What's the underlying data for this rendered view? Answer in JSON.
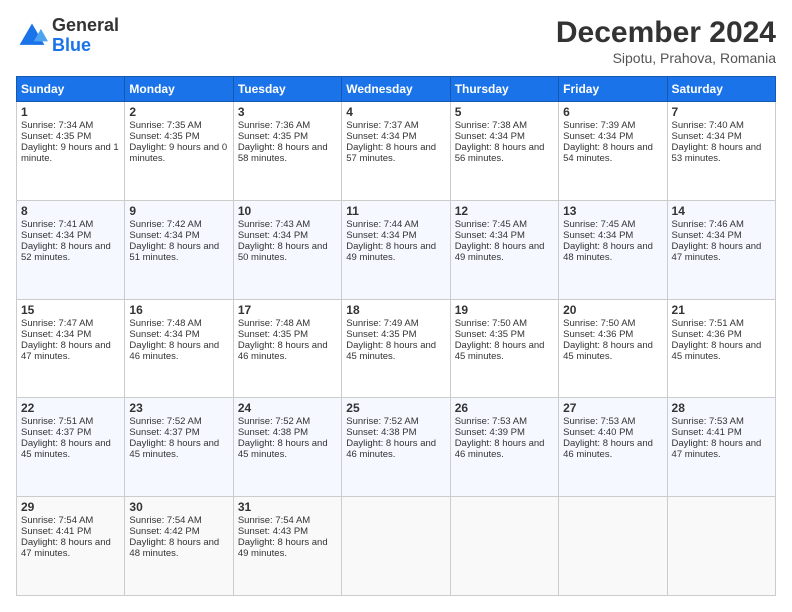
{
  "logo": {
    "line1": "General",
    "line2": "Blue"
  },
  "title": "December 2024",
  "subtitle": "Sipotu, Prahova, Romania",
  "days": [
    "Sunday",
    "Monday",
    "Tuesday",
    "Wednesday",
    "Thursday",
    "Friday",
    "Saturday"
  ],
  "weeks": [
    [
      {
        "day": "1",
        "sunrise": "7:34 AM",
        "sunset": "4:35 PM",
        "daylight": "9 hours and 1 minute."
      },
      {
        "day": "2",
        "sunrise": "7:35 AM",
        "sunset": "4:35 PM",
        "daylight": "9 hours and 0 minutes."
      },
      {
        "day": "3",
        "sunrise": "7:36 AM",
        "sunset": "4:35 PM",
        "daylight": "8 hours and 58 minutes."
      },
      {
        "day": "4",
        "sunrise": "7:37 AM",
        "sunset": "4:34 PM",
        "daylight": "8 hours and 57 minutes."
      },
      {
        "day": "5",
        "sunrise": "7:38 AM",
        "sunset": "4:34 PM",
        "daylight": "8 hours and 56 minutes."
      },
      {
        "day": "6",
        "sunrise": "7:39 AM",
        "sunset": "4:34 PM",
        "daylight": "8 hours and 54 minutes."
      },
      {
        "day": "7",
        "sunrise": "7:40 AM",
        "sunset": "4:34 PM",
        "daylight": "8 hours and 53 minutes."
      }
    ],
    [
      {
        "day": "8",
        "sunrise": "7:41 AM",
        "sunset": "4:34 PM",
        "daylight": "8 hours and 52 minutes."
      },
      {
        "day": "9",
        "sunrise": "7:42 AM",
        "sunset": "4:34 PM",
        "daylight": "8 hours and 51 minutes."
      },
      {
        "day": "10",
        "sunrise": "7:43 AM",
        "sunset": "4:34 PM",
        "daylight": "8 hours and 50 minutes."
      },
      {
        "day": "11",
        "sunrise": "7:44 AM",
        "sunset": "4:34 PM",
        "daylight": "8 hours and 49 minutes."
      },
      {
        "day": "12",
        "sunrise": "7:45 AM",
        "sunset": "4:34 PM",
        "daylight": "8 hours and 49 minutes."
      },
      {
        "day": "13",
        "sunrise": "7:45 AM",
        "sunset": "4:34 PM",
        "daylight": "8 hours and 48 minutes."
      },
      {
        "day": "14",
        "sunrise": "7:46 AM",
        "sunset": "4:34 PM",
        "daylight": "8 hours and 47 minutes."
      }
    ],
    [
      {
        "day": "15",
        "sunrise": "7:47 AM",
        "sunset": "4:34 PM",
        "daylight": "8 hours and 47 minutes."
      },
      {
        "day": "16",
        "sunrise": "7:48 AM",
        "sunset": "4:34 PM",
        "daylight": "8 hours and 46 minutes."
      },
      {
        "day": "17",
        "sunrise": "7:48 AM",
        "sunset": "4:35 PM",
        "daylight": "8 hours and 46 minutes."
      },
      {
        "day": "18",
        "sunrise": "7:49 AM",
        "sunset": "4:35 PM",
        "daylight": "8 hours and 45 minutes."
      },
      {
        "day": "19",
        "sunrise": "7:50 AM",
        "sunset": "4:35 PM",
        "daylight": "8 hours and 45 minutes."
      },
      {
        "day": "20",
        "sunrise": "7:50 AM",
        "sunset": "4:36 PM",
        "daylight": "8 hours and 45 minutes."
      },
      {
        "day": "21",
        "sunrise": "7:51 AM",
        "sunset": "4:36 PM",
        "daylight": "8 hours and 45 minutes."
      }
    ],
    [
      {
        "day": "22",
        "sunrise": "7:51 AM",
        "sunset": "4:37 PM",
        "daylight": "8 hours and 45 minutes."
      },
      {
        "day": "23",
        "sunrise": "7:52 AM",
        "sunset": "4:37 PM",
        "daylight": "8 hours and 45 minutes."
      },
      {
        "day": "24",
        "sunrise": "7:52 AM",
        "sunset": "4:38 PM",
        "daylight": "8 hours and 45 minutes."
      },
      {
        "day": "25",
        "sunrise": "7:52 AM",
        "sunset": "4:38 PM",
        "daylight": "8 hours and 46 minutes."
      },
      {
        "day": "26",
        "sunrise": "7:53 AM",
        "sunset": "4:39 PM",
        "daylight": "8 hours and 46 minutes."
      },
      {
        "day": "27",
        "sunrise": "7:53 AM",
        "sunset": "4:40 PM",
        "daylight": "8 hours and 46 minutes."
      },
      {
        "day": "28",
        "sunrise": "7:53 AM",
        "sunset": "4:41 PM",
        "daylight": "8 hours and 47 minutes."
      }
    ],
    [
      {
        "day": "29",
        "sunrise": "7:54 AM",
        "sunset": "4:41 PM",
        "daylight": "8 hours and 47 minutes."
      },
      {
        "day": "30",
        "sunrise": "7:54 AM",
        "sunset": "4:42 PM",
        "daylight": "8 hours and 48 minutes."
      },
      {
        "day": "31",
        "sunrise": "7:54 AM",
        "sunset": "4:43 PM",
        "daylight": "8 hours and 49 minutes."
      },
      null,
      null,
      null,
      null
    ]
  ]
}
